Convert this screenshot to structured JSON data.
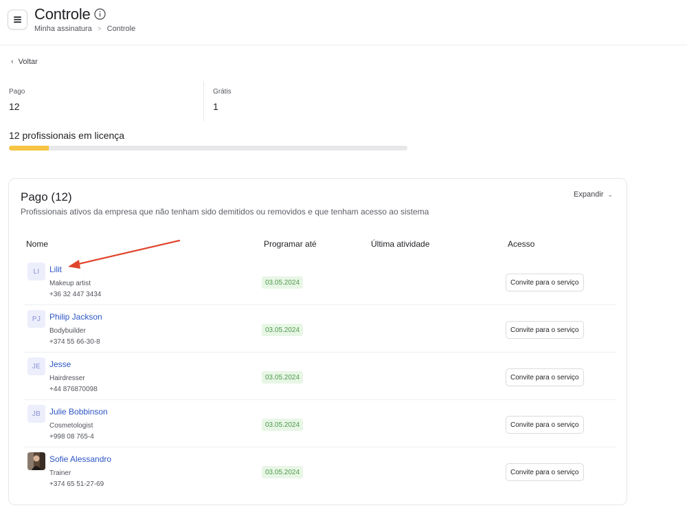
{
  "header": {
    "title": "Controle",
    "breadcrumb": [
      "Minha assinatura",
      "Controle"
    ]
  },
  "back_label": "Voltar",
  "stats": [
    {
      "label": "Pago",
      "value": "12"
    },
    {
      "label": "Grátis",
      "value": "1"
    }
  ],
  "license": {
    "text": "12 profissionais em licença",
    "progress_fraction": 0.1
  },
  "card": {
    "title": "Pago (12)",
    "description": "Profissionais ativos da empresa que não tenham sido demitidos ou removidos e que tenham acesso ao sistema",
    "expand_label": "Expandir",
    "columns": [
      "Nome",
      "Programar até",
      "Última atividade",
      "Acesso"
    ],
    "rows": [
      {
        "initials": "LI",
        "name": "Lilit",
        "role": "Makeup artist",
        "phone": "+36 32 447 3434",
        "date": "03.05.2024",
        "action": "Convite para o serviço"
      },
      {
        "initials": "PJ",
        "name": "Philip Jackson",
        "role": "Bodybuilder",
        "phone": "+374 55 66-30-8",
        "date": "03.05.2024",
        "action": "Convite para o serviço"
      },
      {
        "initials": "JE",
        "name": "Jesse",
        "role": "Hairdresser",
        "phone": "+44 876870098",
        "date": "03.05.2024",
        "action": "Convite para o serviço"
      },
      {
        "initials": "JB",
        "name": "Julie Bobbinson",
        "role": "Cosmetologist",
        "phone": "+998 08 765-4",
        "date": "03.05.2024",
        "action": "Convite para o serviço"
      },
      {
        "initials": "",
        "name": "Sofie Alessandro",
        "role": "Trainer",
        "phone": "+374 65 51-27-69",
        "date": "03.05.2024",
        "action": "Convite para o serviço"
      }
    ]
  },
  "colors": {
    "link": "#2d55c4",
    "progress": "#f6c443",
    "badge_bg": "#e8f6e6",
    "badge_text": "#4d9a4a",
    "annotation_arrow": "#e0442c"
  },
  "icons": {
    "menu": "hamburger-icon",
    "info": "info-circle-icon",
    "back": "chevron-left-icon",
    "expand": "chevron-down-icon"
  }
}
